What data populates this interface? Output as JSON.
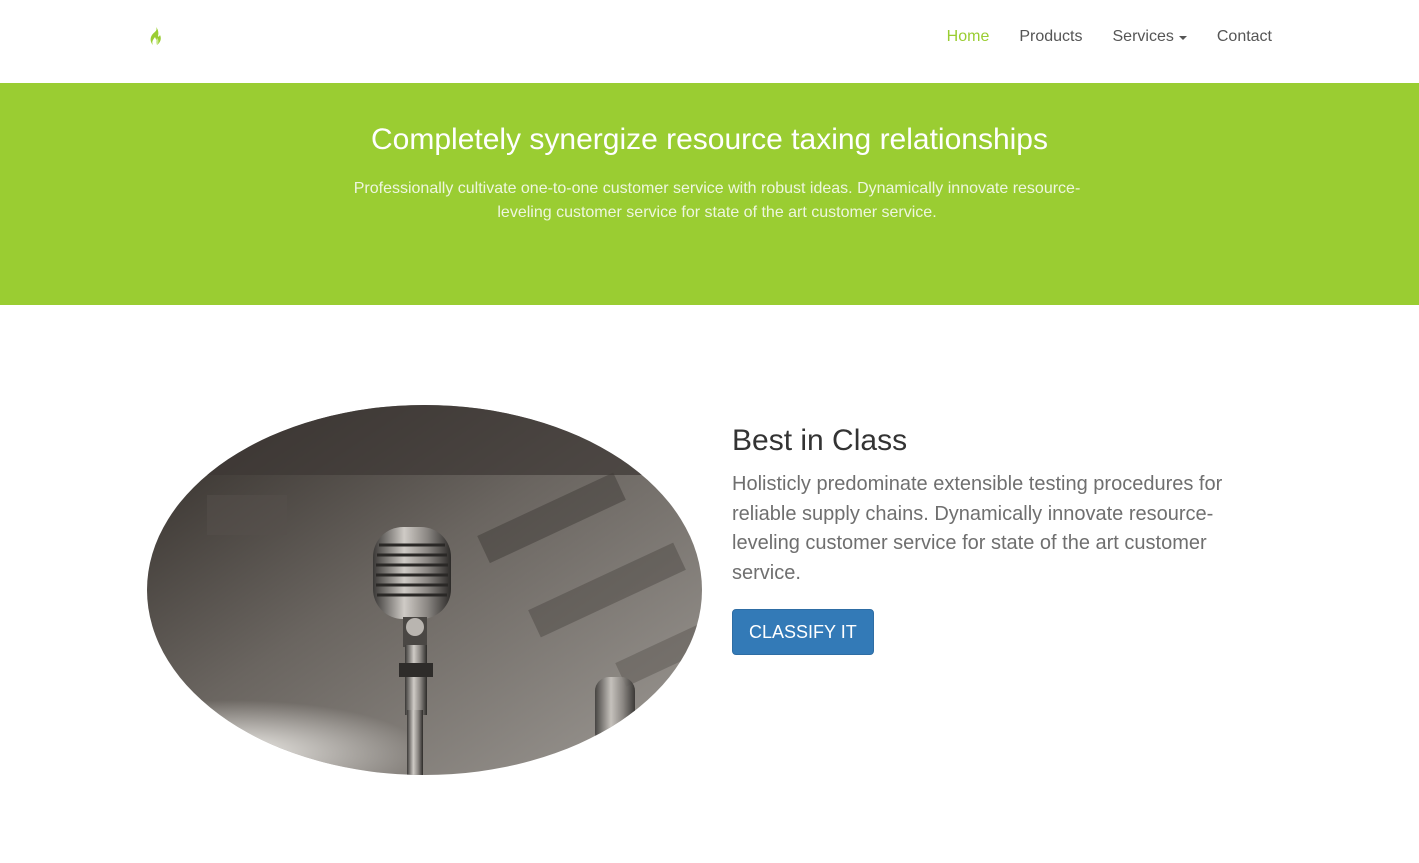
{
  "nav": {
    "brand_icon": "flame-logo-icon",
    "items": [
      {
        "label": "Home",
        "active": true
      },
      {
        "label": "Products",
        "active": false
      },
      {
        "label": "Services",
        "active": false,
        "dropdown": true
      },
      {
        "label": "Contact",
        "active": false
      }
    ]
  },
  "hero": {
    "title": "Completely synergize resource taxing relationships",
    "subtitle": "Professionally cultivate one-to-one customer service with robust ideas. Dynamically innovate resource-leveling customer service for state of the art customer service."
  },
  "feature": {
    "image_icon": "microphone-photo",
    "title": "Best in Class",
    "body": "Holisticly predominate extensible testing procedures for reliable supply chains. Dynamically innovate resource-leveling customer service for state of the art customer service.",
    "button_label": "CLASSIFY IT"
  },
  "colors": {
    "accent": "#9acd32",
    "button": "#337ab7",
    "text_dark": "#333333",
    "text_muted": "#6f6f6f"
  }
}
